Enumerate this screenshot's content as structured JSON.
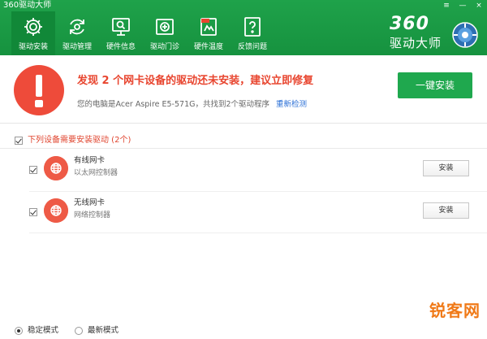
{
  "window": {
    "title": "360驱动大师",
    "controls": [
      "≡",
      "—",
      "×"
    ]
  },
  "nav": [
    {
      "label": "驱动安装",
      "icon": "gear-icon",
      "active": true
    },
    {
      "label": "驱动管理",
      "icon": "refresh-icon",
      "active": false
    },
    {
      "label": "硬件信息",
      "icon": "monitor-icon",
      "active": false
    },
    {
      "label": "驱动门诊",
      "icon": "medical-kit-icon",
      "active": false
    },
    {
      "label": "硬件温度",
      "icon": "thermometer-icon",
      "active": false
    },
    {
      "label": "反馈问题",
      "icon": "question-icon",
      "active": false
    }
  ],
  "brand": {
    "number": "360",
    "name": "驱动大师"
  },
  "banner": {
    "title": "发现 2 个网卡设备的驱动还未安装，建议立即修复",
    "subtitle": "您的电脑是Acer Aspire E5-571G，共找到2个驱动程序",
    "rescan_link": "重新检测",
    "install_all_label": "一键安装"
  },
  "section": {
    "header": "下列设备需要安装驱动 (2个)",
    "devices": [
      {
        "name": "有线网卡",
        "description": "以太网控制器",
        "install_label": "安装",
        "checked": true
      },
      {
        "name": "无线网卡",
        "description": "网络控制器",
        "install_label": "安装",
        "checked": true
      }
    ]
  },
  "footer": {
    "modes": [
      {
        "label": "稳定模式",
        "selected": true
      },
      {
        "label": "最新模式",
        "selected": false
      }
    ]
  },
  "watermark": "锐客网",
  "colors": {
    "header_green": "#1fa24a",
    "alert_red": "#ee4b3a",
    "install_green": "#1fa84e",
    "link_blue": "#2a6fd6",
    "watermark_orange": "#f07a18"
  }
}
